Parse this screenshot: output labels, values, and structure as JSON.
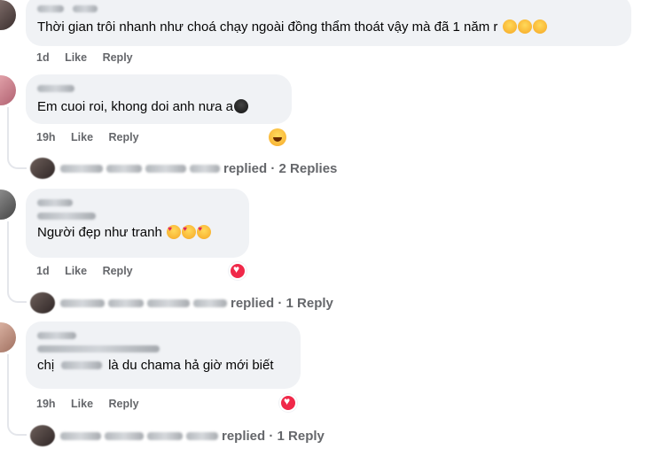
{
  "comments": [
    {
      "text": "Thời gian trôi nhanh như choá chạy ngoài đồng thẩm thoát vậy mà đã 1 năm r",
      "emoji": [
        "rolling-laughing-emoji",
        "rolling-laughing-emoji",
        "rolling-laughing-emoji"
      ],
      "time": "1d",
      "like_label": "Like",
      "reply_label": "Reply"
    },
    {
      "text": "Em cuoi roi, khong doi anh nưa a",
      "emoji": [
        "penguin-emoji"
      ],
      "time": "19h",
      "like_label": "Like",
      "reply_label": "Reply",
      "reaction": "haha-reaction-icon",
      "replies_label": "replied · 2 Replies"
    },
    {
      "text": "Người đẹp như tranh",
      "emoji": [
        "smiling-hearts-emoji",
        "smiling-hearts-emoji",
        "smiling-hearts-emoji"
      ],
      "time": "1d",
      "like_label": "Like",
      "reply_label": "Reply",
      "reaction": "love-reaction-icon",
      "replies_label": "replied · 1 Reply"
    },
    {
      "text_before": "chị",
      "text_after": "là du chama hả giờ mới biết",
      "time": "19h",
      "like_label": "Like",
      "reply_label": "Reply",
      "reaction": "love-reaction-icon",
      "replies_label": "replied · 1 Reply"
    }
  ],
  "colors": {
    "bubble": "#f0f2f5",
    "meta_text": "#65676b",
    "body_text": "#050505",
    "love_red": "#f02849"
  }
}
